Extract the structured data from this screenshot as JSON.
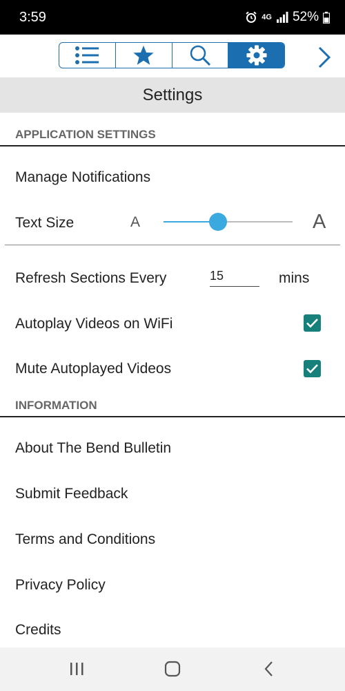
{
  "status_bar": {
    "time": "3:59",
    "network": "4G",
    "battery": "52%"
  },
  "toolbar": {
    "tabs": [
      {
        "icon": "list-icon",
        "active": false
      },
      {
        "icon": "star-icon",
        "active": false
      },
      {
        "icon": "search-icon",
        "active": false
      },
      {
        "icon": "gear-icon",
        "active": true
      }
    ],
    "next_icon": "chevron-right-icon"
  },
  "page": {
    "title": "Settings"
  },
  "application_settings": {
    "header": "APPLICATION SETTINGS",
    "manage_notifications": "Manage Notifications",
    "text_size": {
      "label": "Text Size",
      "small_a": "A",
      "large_a": "A",
      "level": 0.42
    },
    "refresh": {
      "label": "Refresh Sections Every",
      "value": "15",
      "unit": "mins"
    },
    "autoplay_wifi": {
      "label": "Autoplay Videos on WiFi",
      "checked": true
    },
    "mute_autoplay": {
      "label": "Mute Autoplayed Videos",
      "checked": true
    }
  },
  "information": {
    "header": "INFORMATION",
    "items": [
      "About The Bend Bulletin",
      "Submit Feedback",
      "Terms and Conditions",
      "Privacy Policy",
      "Credits"
    ]
  },
  "colors": {
    "accent": "#1b6fb0",
    "slider": "#3aa9e0",
    "checkbox": "#17807a"
  }
}
